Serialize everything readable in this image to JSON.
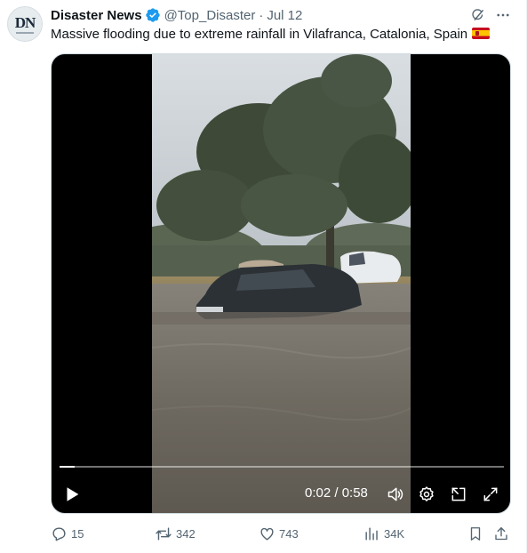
{
  "post": {
    "author": {
      "name": "Disaster News",
      "handle": "@Top_Disaster",
      "avatar_text": "DN",
      "verified": true
    },
    "date": "Jul 12",
    "separator": "·",
    "text": "Massive flooding due to extreme rainfall in Vilafranca, Catalonia, Spain"
  },
  "video": {
    "current_time": "0:02",
    "duration": "0:58",
    "time_display": "0:02 / 0:58",
    "progress_fraction": 0.034,
    "state": "paused"
  },
  "actions": {
    "replies": "15",
    "reposts": "342",
    "likes": "743",
    "views": "34K"
  },
  "icons": [
    "verified-badge-icon",
    "grok-icon",
    "more-icon",
    "play-icon",
    "volume-icon",
    "settings-icon",
    "pop-out-icon",
    "fullscreen-icon",
    "reply-icon",
    "repost-icon",
    "like-icon",
    "views-icon",
    "bookmark-icon",
    "share-icon"
  ],
  "colors": {
    "verified": "#1d9bf0",
    "secondary_text": "#536471",
    "text": "#0f1419"
  }
}
